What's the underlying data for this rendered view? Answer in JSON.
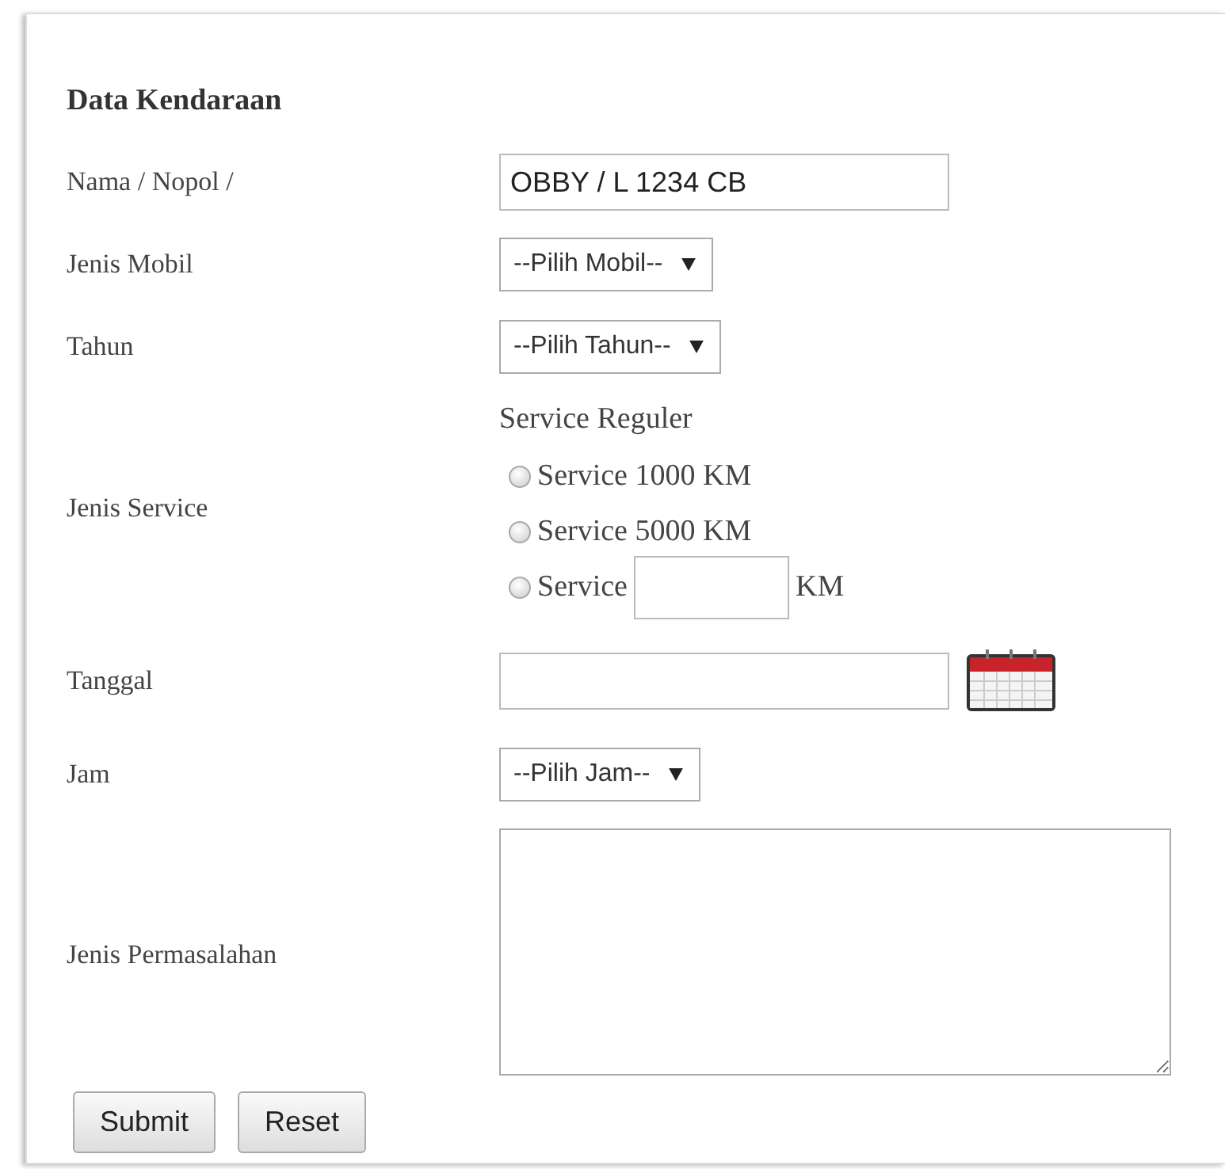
{
  "section_title": "Data Kendaraan",
  "fields": [
    {
      "kind": "text",
      "label": "Nama / Nopol /",
      "value": "OBBY / L 1234 CB"
    },
    {
      "kind": "select",
      "label": "Jenis Mobil",
      "value": "--Pilih Mobil--"
    },
    {
      "kind": "select",
      "label": "Tahun",
      "value": "--Pilih Tahun--"
    },
    {
      "kind": "radio",
      "label": "Jenis Service",
      "group_title": "Service Reguler",
      "options": [
        {
          "text": "Service 1000 KM",
          "selected": false
        },
        {
          "text": "Service 5000 KM",
          "selected": false
        },
        {
          "text": "Service",
          "suffix": "KM",
          "selected": false
        }
      ]
    },
    {
      "kind": "date",
      "label": "Tanggal"
    },
    {
      "kind": "select",
      "label": "Jam",
      "value": "--Pilih Jam--"
    },
    {
      "kind": "textarea",
      "label": "Jenis Permasalahan"
    }
  ],
  "buttons": [
    "Submit",
    "Reset"
  ]
}
